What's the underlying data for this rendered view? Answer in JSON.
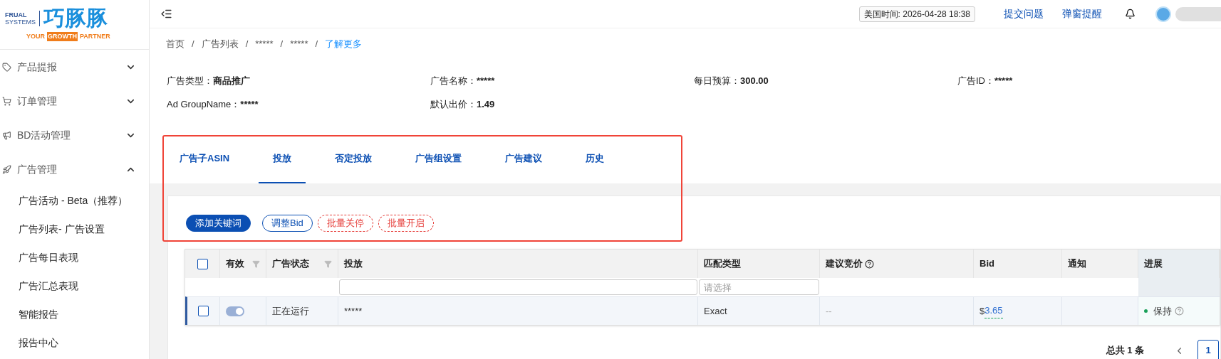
{
  "logo": {
    "line1": "FRUAL",
    "line2": "SYSTEMS",
    "name": "巧豚豚",
    "tagline": [
      {
        "text": "YOUR",
        "highlight": false
      },
      {
        "text": "GROWTH",
        "highlight": true
      },
      {
        "text": "PARTNER",
        "highlight": false
      }
    ]
  },
  "sidebar": {
    "items": [
      {
        "label": "产品提报",
        "expanded": false
      },
      {
        "label": "订单管理",
        "expanded": false
      },
      {
        "label": "BD活动管理",
        "expanded": false
      },
      {
        "label": "广告管理",
        "expanded": true,
        "children": [
          {
            "label": "广告活动 - Beta（推荐）"
          },
          {
            "label": "广告列表- 广告设置"
          },
          {
            "label": "广告每日表现"
          },
          {
            "label": "广告汇总表现"
          },
          {
            "label": "智能报告"
          },
          {
            "label": "报告中心"
          }
        ]
      }
    ]
  },
  "topbar": {
    "time": "美国时间: 2026-04-28 18:38",
    "links": [
      "提交问题",
      "弹窗提醒"
    ]
  },
  "breadcrumb": [
    {
      "label": "首页",
      "link": false
    },
    {
      "separator": "/",
      "label": "广告列表",
      "link": false
    },
    {
      "separator": "/",
      "label": "*****",
      "link": false
    },
    {
      "separator": "/",
      "label": "*****",
      "link": false
    },
    {
      "separator": "/",
      "label": "了解更多",
      "link": true
    }
  ],
  "info": [
    {
      "label": "广告类型：",
      "value": "商品推广"
    },
    {
      "label": "广告名称：",
      "value": "*****"
    },
    {
      "label": "每日预算：",
      "value": "300.00"
    },
    {
      "label": "广告ID：",
      "value": "*****"
    },
    {
      "label": "Ad GroupName：",
      "value": "*****"
    },
    {
      "label": "默认出价：",
      "value": "1.49"
    }
  ],
  "tabs": [
    {
      "label": "广告子ASIN",
      "selected": false
    },
    {
      "label": "投放",
      "selected": true
    },
    {
      "label": "否定投放",
      "selected": false
    },
    {
      "label": "广告组设置",
      "selected": false
    },
    {
      "label": "广告建议",
      "selected": false
    },
    {
      "label": "历史",
      "selected": false
    }
  ],
  "actions": [
    {
      "label": "添加关键词",
      "kind": "primary"
    },
    {
      "label": "调整Bid",
      "kind": "outline"
    },
    {
      "label": "批量关停",
      "kind": "danger"
    },
    {
      "label": "批量开启",
      "kind": "danger"
    }
  ],
  "table": {
    "header_checked": false,
    "columns": [
      {
        "label": "有效",
        "funnel": true
      },
      {
        "label": "广告状态",
        "funnel": true
      },
      {
        "label": "投放",
        "filter": {
          "kind": "input"
        }
      },
      {
        "label": "匹配类型",
        "filter": {
          "kind": "select",
          "placeholder": "请选择"
        }
      },
      {
        "label": "建议竞价",
        "help": true
      },
      {
        "label": "Bid"
      },
      {
        "label": "通知"
      },
      {
        "label": "进展"
      }
    ],
    "rows": [
      {
        "checked": false,
        "current": true,
        "enabled": true,
        "status": "正在运行",
        "targeting": "*****",
        "match": "Exact",
        "suggested": "--",
        "bid_currency": "$",
        "bid": "3.65",
        "progress": "保持",
        "color": "#18a058"
      }
    ]
  },
  "pagination": {
    "total": "总共 1 条",
    "pages": [
      {
        "label": "1",
        "selected": true
      }
    ]
  }
}
